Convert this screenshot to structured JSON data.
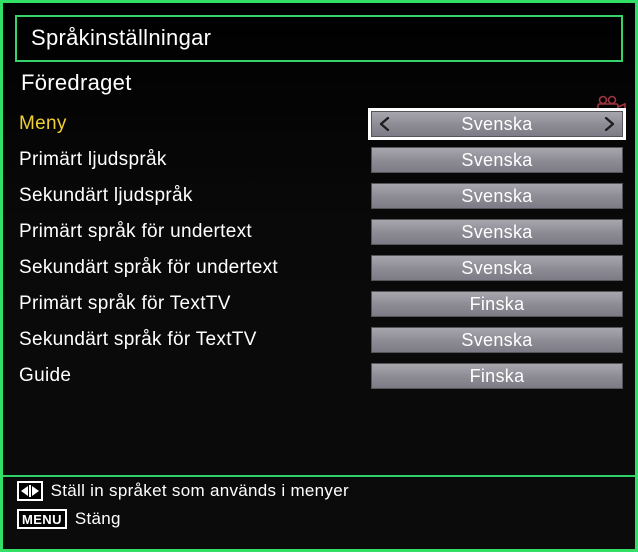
{
  "title": "Språkinställningar",
  "subtitle": "Föredraget",
  "rows": [
    {
      "label": "Meny",
      "value": "Svenska",
      "active": true
    },
    {
      "label": "Primärt ljudspråk",
      "value": "Svenska",
      "active": false
    },
    {
      "label": "Sekundärt ljudspråk",
      "value": "Svenska",
      "active": false
    },
    {
      "label": "Primärt språk för undertext",
      "value": "Svenska",
      "active": false
    },
    {
      "label": "Sekundärt språk för undertext",
      "value": "Svenska",
      "active": false
    },
    {
      "label": "Primärt språk för TextTV",
      "value": "Finska",
      "active": false
    },
    {
      "label": "Sekundärt språk för TextTV",
      "value": "Svenska",
      "active": false
    },
    {
      "label": "Guide",
      "value": "Finska",
      "active": false
    }
  ],
  "footer": {
    "arrows_hint": "Ställ in språket som används i menyer",
    "menu_key": "MENU",
    "menu_hint": "Stäng"
  }
}
